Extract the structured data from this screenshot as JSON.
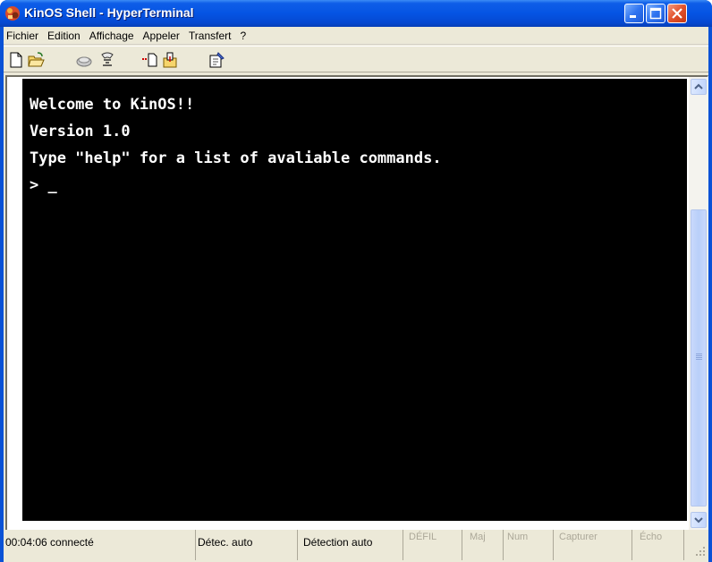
{
  "window": {
    "title": "KinOS Shell - HyperTerminal"
  },
  "menu": [
    {
      "label": "Fichier"
    },
    {
      "label": "Edition"
    },
    {
      "label": "Affichage"
    },
    {
      "label": "Appeler"
    },
    {
      "label": "Transfert"
    },
    {
      "label": "?"
    }
  ],
  "toolbar": [
    {
      "icon": "new-document-icon"
    },
    {
      "icon": "open-folder-icon"
    },
    {
      "icon": "call-icon"
    },
    {
      "icon": "disconnect-icon"
    },
    {
      "icon": "send-icon"
    },
    {
      "icon": "receive-icon"
    },
    {
      "icon": "properties-icon"
    }
  ],
  "terminal": {
    "lines": [
      "Welcome to KinOS!!",
      "Version 1.0",
      "Type \"help\" for a list of avaliable commands.",
      "> _"
    ]
  },
  "status": {
    "connection": "00:04:06 connecté",
    "detect1": "Détec. auto",
    "detect2": "Détection auto",
    "scroll": "DÉFIL",
    "caps": "Maj",
    "num": "Num",
    "capture": "Capturer",
    "echo": "Écho"
  },
  "colors": {
    "titlebar": "#0554e3",
    "terminal_bg": "#000000",
    "terminal_fg": "#ffffff",
    "chrome": "#ece9d8"
  }
}
